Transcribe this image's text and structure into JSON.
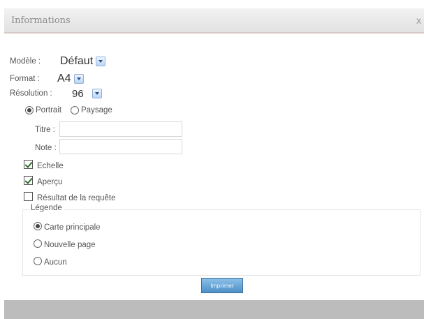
{
  "dialog": {
    "title": "Informations",
    "close_glyph": "x"
  },
  "form": {
    "modele": {
      "label": "Modèle :",
      "value": "Défaut"
    },
    "format": {
      "label": "Format :",
      "value": "A4"
    },
    "resolution": {
      "label": "Résolution :",
      "value": "96"
    },
    "orientation": {
      "portrait_label": "Portrait",
      "paysage_label": "Paysage",
      "selected": "Portrait"
    },
    "titre": {
      "label": "Titre :",
      "value": ""
    },
    "note": {
      "label": "Note :",
      "value": ""
    },
    "checkboxes": [
      {
        "label": "Echelle",
        "checked": true
      },
      {
        "label": "Aperçu",
        "checked": true
      },
      {
        "label": "Résultat de la requête",
        "checked": false
      }
    ],
    "legende": {
      "label": "Légende",
      "options": [
        "Carte principale",
        "Nouvelle page",
        "Aucun"
      ],
      "selected": "Carte principale"
    },
    "submit_label": "Imprimer"
  },
  "colors": {
    "titlebar": "#e8e8e8",
    "button": "#5a9ad2",
    "footer": "#bcbcbc",
    "checkmark": "#2a6e2a"
  }
}
